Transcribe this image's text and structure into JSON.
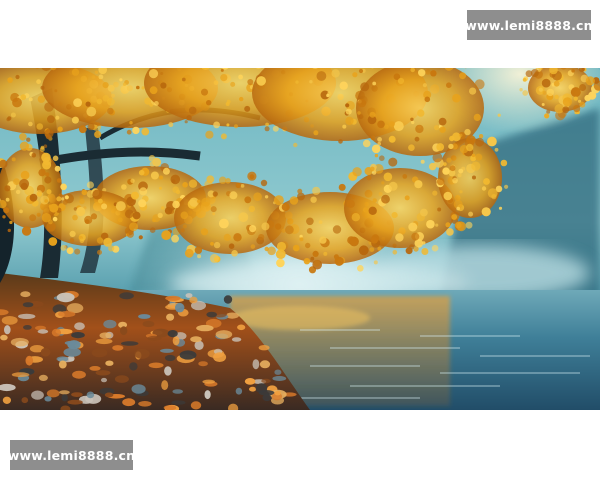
{
  "watermarks": {
    "top_text": "www.lemi8888.cn",
    "bottom_text": "www.lemi8888.cn"
  },
  "photo": {
    "subject": "golden-autumn-tree-over-misty-lake",
    "palette": {
      "leaves": "#e8a21c",
      "leaves_highlight": "#ffd45a",
      "mist": "#9fd0d8",
      "water": "#3a7c95",
      "shore": "#c8641c"
    }
  }
}
